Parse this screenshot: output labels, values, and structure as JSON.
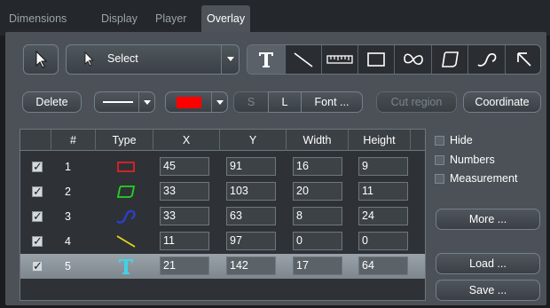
{
  "tabs": [
    {
      "label": "Dimensions",
      "active": false
    },
    {
      "label": "Display",
      "active": false
    },
    {
      "label": "Player",
      "active": false
    },
    {
      "label": "Overlay",
      "active": true
    }
  ],
  "toolbar": {
    "select_label": "Select",
    "tools": [
      "text-tool-icon",
      "line-tool-icon",
      "ruler-tool-icon",
      "rectangle-tool-icon",
      "closed-curve-tool-icon",
      "polygon-tool-icon",
      "open-curve-tool-icon",
      "arrow-tool-icon"
    ]
  },
  "actions": {
    "delete_label": "Delete",
    "s_label": "S",
    "l_label": "L",
    "font_label": "Font ...",
    "cut_region_label": "Cut region",
    "coordinate_label": "Coordinate",
    "color": "#ff0000"
  },
  "table": {
    "headers": [
      "#",
      "Type",
      "X",
      "Y",
      "Width",
      "Height"
    ],
    "rows": [
      {
        "num": "1",
        "type": "rectangle",
        "x": "45",
        "y": "91",
        "width": "16",
        "height": "9",
        "checked": true
      },
      {
        "num": "2",
        "type": "polygon",
        "x": "33",
        "y": "103",
        "width": "20",
        "height": "11",
        "checked": true
      },
      {
        "num": "3",
        "type": "curve",
        "x": "33",
        "y": "63",
        "width": "8",
        "height": "24",
        "checked": true
      },
      {
        "num": "4",
        "type": "line",
        "x": "11",
        "y": "97",
        "width": "0",
        "height": "0",
        "checked": true
      },
      {
        "num": "5",
        "type": "text",
        "x": "21",
        "y": "142",
        "width": "17",
        "height": "64",
        "checked": true,
        "selected": true
      }
    ]
  },
  "options": {
    "hide_label": "Hide",
    "numbers_label": "Numbers",
    "measurement_label": "Measurement"
  },
  "side_buttons": {
    "more_label": "More ...",
    "load_label": "Load ...",
    "save_label": "Save ..."
  },
  "colors": {
    "rectangle": "#e0202a",
    "polygon": "#26d41f",
    "curve": "#2a3fd0",
    "line": "#e4d51c",
    "text": "#3fd3e8"
  }
}
